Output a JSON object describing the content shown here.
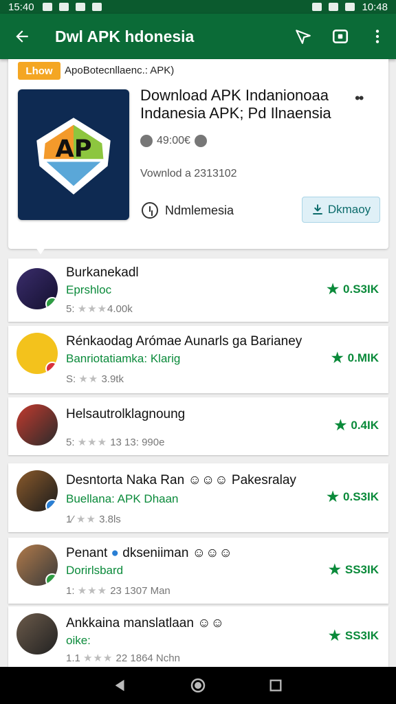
{
  "status_bar": {
    "time": "15:40",
    "right_time": "10:48"
  },
  "app_bar": {
    "title": "Dwl APK hdonesia"
  },
  "detail": {
    "badge": "Lhow",
    "crumb_prefix": "ApoBotecnlla",
    "crumb_highlight": "",
    "crumb_suffix": "enc.: APK)",
    "app_title": "Download APK Indanionoaa Indanesia APK; Pd Ilnaensia",
    "rating_text": "49:00€",
    "downloads": "Vownlod a 2313102",
    "region": "Ndmlemesia",
    "download_button": "Dkmaoy",
    "icon_letters": "AP"
  },
  "items": [
    {
      "title": "Burkanekadl",
      "sub": "Eprshloc",
      "meta_prefix": "5:",
      "meta_suffix": "4.00k",
      "score": "0.S3IK"
    },
    {
      "title": "Rénkaodag Arómae Aunarls ga Barianey",
      "sub": "Banriotatiamka: Klarig",
      "meta_prefix": "S:",
      "meta_suffix": "3.9tk",
      "score": "0.MIK"
    },
    {
      "title": "Helsautrolklagnoung",
      "sub": "",
      "meta_prefix": "5:",
      "meta_suffix": "13  13: 990e",
      "score": "0.4IK"
    },
    {
      "title": "Desntorta Naka Ran",
      "title_tail": "Pakesralay",
      "sub": "Buellana: APK Dhaan",
      "meta_prefix": "1⁄",
      "meta_suffix": "3.8ls",
      "score": "0.S3IK"
    },
    {
      "title": "Penant",
      "title_tail": "dkseniiman",
      "sub": "Dorirlsbard",
      "meta_prefix": "1:",
      "meta_suffix": "23  1307 Man",
      "score": "SS3IK"
    },
    {
      "title": "Ankkaina manslatlaan",
      "sub": "oike:",
      "meta_prefix": "1.1",
      "meta_suffix": "22  1864 Nchn",
      "score": "SS3IK"
    }
  ],
  "colors": {
    "app_bar": "#0b6b37",
    "accent_green": "#0a8a3a",
    "badge": "#f4a623"
  }
}
